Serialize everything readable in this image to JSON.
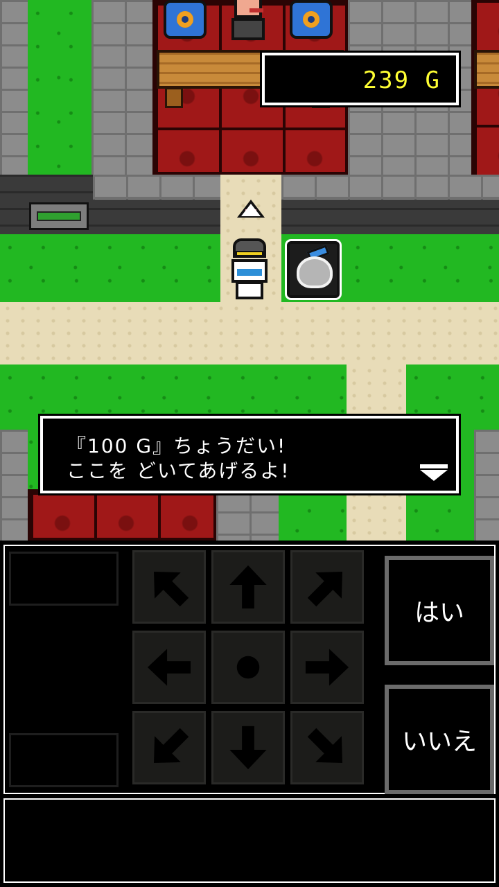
{
  "hud": {
    "gold_display": "239 G"
  },
  "dialog": {
    "line1": "『100 G』ちょうだい!",
    "line2": "ここを どいてあげるよ!",
    "advance_icon": "triangle-down-icon"
  },
  "controls": {
    "dpad": [
      {
        "name": "up-left-arrow-icon",
        "rotate": 315
      },
      {
        "name": "up-arrow-icon",
        "rotate": 0
      },
      {
        "name": "up-right-arrow-icon",
        "rotate": 45
      },
      {
        "name": "left-arrow-icon",
        "rotate": 270
      },
      {
        "name": "center-dot-icon",
        "rotate": 0
      },
      {
        "name": "right-arrow-icon",
        "rotate": 90
      },
      {
        "name": "down-left-arrow-icon",
        "rotate": 225
      },
      {
        "name": "down-arrow-icon",
        "rotate": 180
      },
      {
        "name": "down-right-arrow-icon",
        "rotate": 135
      }
    ],
    "yes_label": "はい",
    "no_label": "いいえ"
  },
  "colors": {
    "gold_text": "#ffff33",
    "grass": "#22b822",
    "path": "#e8dcb8",
    "red_floor": "#a01818",
    "key_arrow": "#000000"
  }
}
